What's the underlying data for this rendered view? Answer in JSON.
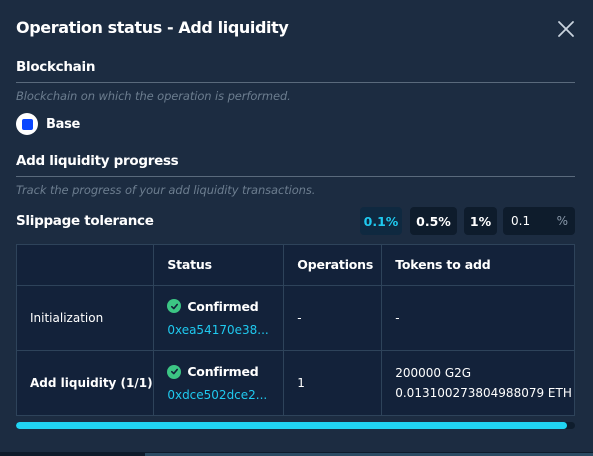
{
  "modal": {
    "title": "Operation status - Add liquidity"
  },
  "blockchain": {
    "title": "Blockchain",
    "description": "Blockchain on which the operation is performed.",
    "chain_name": "Base"
  },
  "progress_section": {
    "title": "Add liquidity progress",
    "description": "Track the progress of your add liquidity transactions."
  },
  "slippage": {
    "label": "Slippage tolerance",
    "options": [
      "0.1%",
      "0.5%",
      "1%"
    ],
    "selected": "0.1%",
    "custom_value": "0.1",
    "custom_unit": "%"
  },
  "table": {
    "headers": [
      "",
      "Status",
      "Operations",
      "Tokens to add"
    ],
    "rows": [
      {
        "step": "Initialization",
        "status": "Confirmed",
        "tx": "0xea54170e38...",
        "operations": "-",
        "tokens": [
          "-"
        ]
      },
      {
        "step": "Add liquidity (1/1)",
        "status": "Confirmed",
        "tx": "0xdce502dce2...",
        "operations": "1",
        "tokens": [
          "200000 G2G",
          "0.013100273804988079 ETH"
        ]
      }
    ]
  },
  "progress": {
    "fraction": 0.985
  },
  "colors": {
    "accent": "#1fc9ef",
    "confirmed": "#3cc584",
    "background": "#1c2c41",
    "chain_brand": "#0a46ff"
  },
  "icons": {
    "close": "close-icon",
    "chain": "base-chain-icon",
    "status": "check-circle-icon"
  }
}
